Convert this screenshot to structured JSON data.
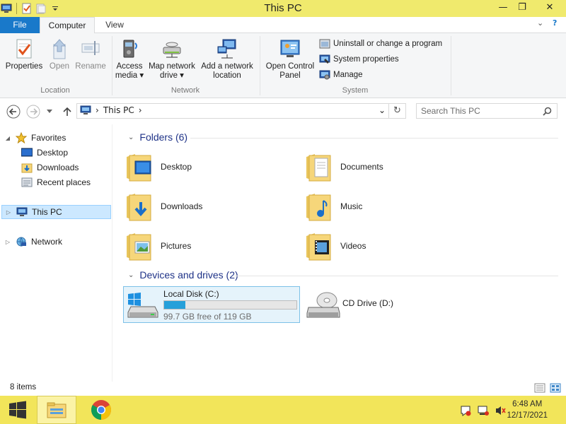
{
  "window": {
    "title": "This PC",
    "minimize_glyph": "—",
    "maximize_glyph": "❐",
    "close_glyph": "✕"
  },
  "tabs": {
    "file": "File",
    "computer": "Computer",
    "view": "View",
    "collapse_glyph": "⌄",
    "help_glyph": "?"
  },
  "ribbon": {
    "location": {
      "label": "Location",
      "properties": "Properties",
      "open": "Open",
      "rename": "Rename"
    },
    "network": {
      "label": "Network",
      "access_media_l1": "Access",
      "access_media_l2": "media ▾",
      "map_drive_l1": "Map network",
      "map_drive_l2": "drive ▾",
      "add_location_l1": "Add a network",
      "add_location_l2": "location"
    },
    "system": {
      "label": "System",
      "open_cp_l1": "Open Control",
      "open_cp_l2": "Panel",
      "uninstall": "Uninstall or change a program",
      "system_properties": "System properties",
      "manage": "Manage"
    }
  },
  "address": {
    "path": "This PC",
    "separator_glyph": "›",
    "dropdown_glyph": "⌄",
    "refresh_glyph": "↻"
  },
  "search": {
    "placeholder": "Search This PC"
  },
  "nav_pane": {
    "favorites": "Favorites",
    "desktop": "Desktop",
    "downloads": "Downloads",
    "recent_places": "Recent places",
    "this_pc": "This PC",
    "network": "Network"
  },
  "content": {
    "folders_header": "Folders (6)",
    "folders": [
      {
        "name": "Desktop",
        "icon": "desktop-folder-icon"
      },
      {
        "name": "Documents",
        "icon": "documents-folder-icon"
      },
      {
        "name": "Downloads",
        "icon": "downloads-folder-icon"
      },
      {
        "name": "Music",
        "icon": "music-folder-icon"
      },
      {
        "name": "Pictures",
        "icon": "pictures-folder-icon"
      },
      {
        "name": "Videos",
        "icon": "videos-folder-icon"
      }
    ],
    "devices_header": "Devices and drives (2)",
    "drives": [
      {
        "name": "Local Disk (C:)",
        "free": "99.7 GB free of 119 GB",
        "used_fraction": 0.162
      },
      {
        "name": "CD Drive (D:)"
      }
    ]
  },
  "status": {
    "items": "8 items"
  },
  "taskbar": {
    "time": "6:48 AM",
    "date": "12/17/2021"
  },
  "colors": {
    "title_bar": "#f0ea6d",
    "taskbar": "#f2e55a",
    "file_tab": "#1979ca",
    "accent_header": "#1e3287",
    "selection": "#cce8ff",
    "drive_fill": "#26a0da"
  }
}
